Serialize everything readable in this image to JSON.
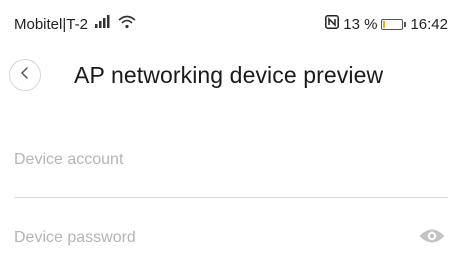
{
  "status_bar": {
    "carrier": "Mobitel|T-2",
    "battery_percent": "13 %",
    "battery_level": 0.13,
    "time": "16:42",
    "icons": [
      "signal-icon",
      "wifi-icon",
      "nfc-icon",
      "battery-icon"
    ]
  },
  "header": {
    "title": "AP networking device preview",
    "back_icon": "chevron-left-icon"
  },
  "form": {
    "account_placeholder": "Device account",
    "account_value": "",
    "password_placeholder": "Device password",
    "password_value": "",
    "password_toggle_icon": "eye-icon"
  },
  "colors": {
    "placeholder": "#b5b5b5",
    "divider": "#dcdcdc",
    "battery_low": "#f5a623"
  }
}
